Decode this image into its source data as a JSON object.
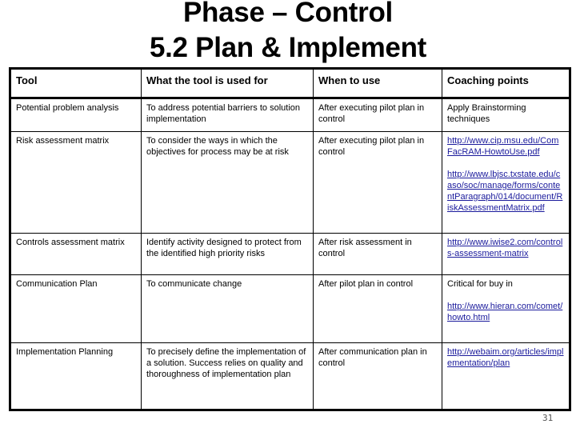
{
  "title": {
    "line1": "Phase – Control",
    "line2": "5.2 Plan & Implement"
  },
  "table": {
    "headers": [
      "Tool",
      "What the tool is used for",
      "When to use",
      "Coaching points"
    ],
    "rows": [
      {
        "tool": "Potential problem analysis",
        "purpose": "To address potential barriers to solution implementation",
        "when": "After executing pilot plan in control",
        "coaching_text": "Apply Brainstorming techniques",
        "links": []
      },
      {
        "tool": "Risk assessment matrix",
        "purpose": "To consider the ways in which the objectives for process may be at risk",
        "when": "After executing pilot plan in control",
        "coaching_text": "",
        "links": [
          "http://www.cip.msu.edu/ComFacRAM-HowtoUse.pdf",
          "http://www.lbjsc.txstate.edu/caso/soc/manage/forms/contentParagraph/014/document/RiskAssessmentMatrix.pdf"
        ]
      },
      {
        "tool": "Controls assessment matrix",
        "purpose": "Identify activity designed to protect from the identified high priority risks",
        "when": "After risk assessment in control",
        "coaching_text": "",
        "links": [
          "http://www.iwise2.com/controls-assessment-matrix"
        ]
      },
      {
        "tool": "Communication Plan",
        "purpose": "To communicate change",
        "when": "After pilot plan in control",
        "coaching_text": "Critical for buy in",
        "links": [
          "http://www.hieran.com/comet/howto.html"
        ]
      },
      {
        "tool": "Implementation Planning",
        "purpose": "To precisely define the implementation of a solution. Success relies on quality and thoroughness of implementation plan",
        "when": "After communication plan in control",
        "coaching_text": "",
        "links": [
          "http://webaim.org/articles/implementation/plan"
        ]
      }
    ]
  },
  "colors": {
    "link": "#1a1a9c",
    "border": "#000000",
    "page_number": "#555555"
  },
  "page_number": "31"
}
